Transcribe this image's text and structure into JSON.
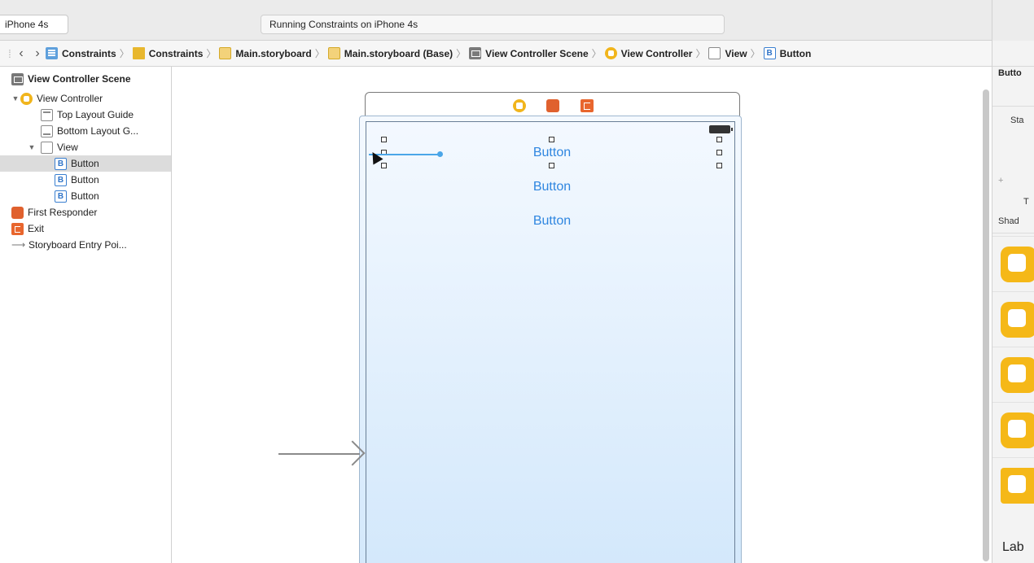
{
  "toolbar": {
    "scheme_device": "iPhone 4s",
    "activity_status": "Running Constraints on iPhone 4s"
  },
  "jumpbar": {
    "items": [
      {
        "label": "Constraints",
        "icon": "file-icon"
      },
      {
        "label": "Constraints",
        "icon": "folder-icon"
      },
      {
        "label": "Main.storyboard",
        "icon": "storyboard-icon"
      },
      {
        "label": "Main.storyboard (Base)",
        "icon": "storyboard-icon"
      },
      {
        "label": "View Controller Scene",
        "icon": "scene-icon"
      },
      {
        "label": "View Controller",
        "icon": "view-controller-icon"
      },
      {
        "label": "View",
        "icon": "view-icon"
      },
      {
        "label": "Button",
        "icon": "button-icon"
      }
    ]
  },
  "outline": {
    "scene_title": "View Controller Scene",
    "view_controller": "View Controller",
    "top_layout_guide": "Top Layout Guide",
    "bottom_layout_guide": "Bottom Layout G...",
    "view": "View",
    "buttons": [
      "Button",
      "Button",
      "Button"
    ],
    "first_responder": "First Responder",
    "exit": "Exit",
    "entry_point": "Storyboard Entry Poi..."
  },
  "canvas": {
    "buttons": [
      "Button",
      "Button",
      "Button"
    ]
  },
  "inspector": {
    "title": "Butto",
    "state_label": "Sta",
    "plus": "+",
    "t_label": "T",
    "shadow_label": "Shad",
    "library_label": "Lab"
  },
  "colors": {
    "accent_blue": "#2f86e0",
    "constraint_blue": "#4ba6e8",
    "vc_yellow": "#f1b51c",
    "responder_orange": "#e0612e"
  }
}
